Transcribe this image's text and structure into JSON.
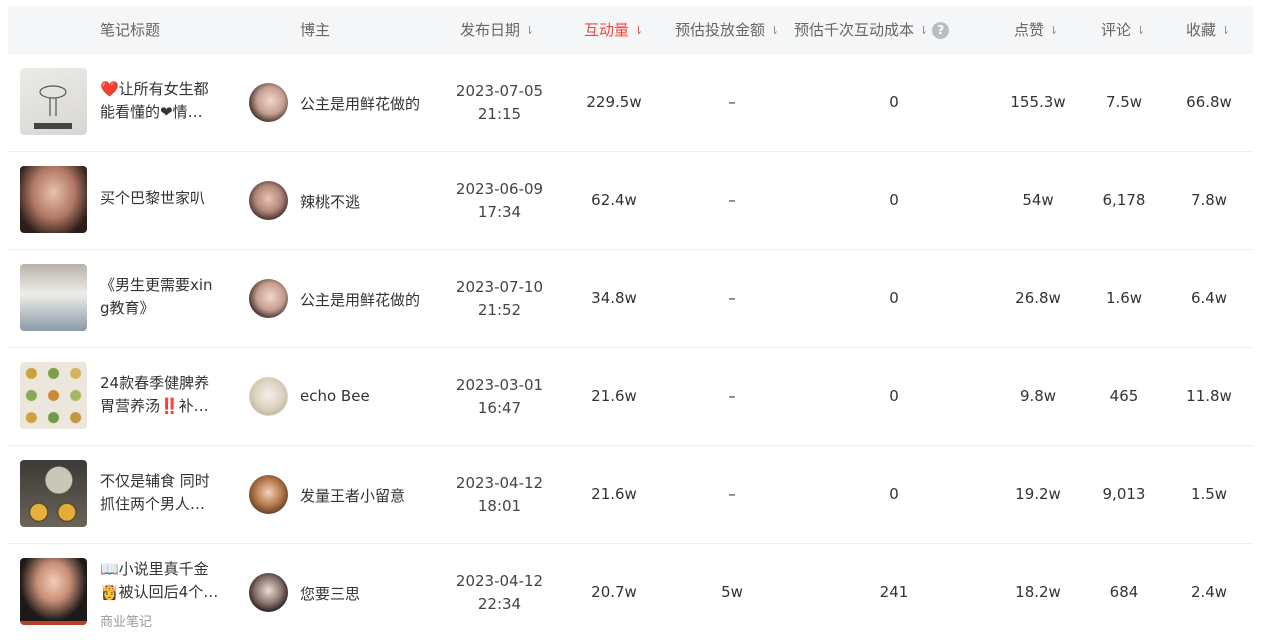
{
  "header": {
    "title": "笔记标题",
    "blogger": "博主",
    "date": "发布日期",
    "interactions": "互动量",
    "est_spend": "预估投放金额",
    "est_cpe": "预估千次互动成本",
    "likes": "点赞",
    "comments": "评论",
    "favorites": "收藏",
    "sort_icon": "sort-icon",
    "help_icon": "?"
  },
  "rows": [
    {
      "title_line1": "❤️让所有女生都",
      "title_line2": "能看懂的❤情…",
      "tag": "",
      "blogger": "公主是用鲜花做的",
      "date": "2023-07-05",
      "time": "21:15",
      "interactions": "229.5w",
      "est_spend": "–",
      "est_cpe": "0",
      "likes": "155.3w",
      "comments": "7.5w",
      "favorites": "66.8w"
    },
    {
      "title_line1": "买个巴黎世家叭",
      "title_line2": "",
      "tag": "",
      "blogger": "辣桃不逃",
      "date": "2023-06-09",
      "time": "17:34",
      "interactions": "62.4w",
      "est_spend": "–",
      "est_cpe": "0",
      "likes": "54w",
      "comments": "6,178",
      "favorites": "7.8w"
    },
    {
      "title_line1": "《男生更需要xin",
      "title_line2": "g教育》",
      "tag": "",
      "blogger": "公主是用鲜花做的",
      "date": "2023-07-10",
      "time": "21:52",
      "interactions": "34.8w",
      "est_spend": "–",
      "est_cpe": "0",
      "likes": "26.8w",
      "comments": "1.6w",
      "favorites": "6.4w"
    },
    {
      "title_line1": "24款春季健脾养",
      "title_line2": "胃营养汤‼️补…",
      "tag": "",
      "blogger": "echo Bee",
      "date": "2023-03-01",
      "time": "16:47",
      "interactions": "21.6w",
      "est_spend": "–",
      "est_cpe": "0",
      "likes": "9.8w",
      "comments": "465",
      "favorites": "11.8w"
    },
    {
      "title_line1": "不仅是辅食 同时",
      "title_line2": "抓住两个男人…",
      "tag": "",
      "blogger": "发量王者小留意",
      "date": "2023-04-12",
      "time": "18:01",
      "interactions": "21.6w",
      "est_spend": "–",
      "est_cpe": "0",
      "likes": "19.2w",
      "comments": "9,013",
      "favorites": "1.5w"
    },
    {
      "title_line1": "📖小说里真千金",
      "title_line2": "👸被认回后4个…",
      "tag": "商业笔记",
      "blogger": "您要三思",
      "date": "2023-04-12",
      "time": "22:34",
      "interactions": "20.7w",
      "est_spend": "5w",
      "est_cpe": "241",
      "likes": "18.2w",
      "comments": "684",
      "favorites": "2.4w"
    }
  ]
}
